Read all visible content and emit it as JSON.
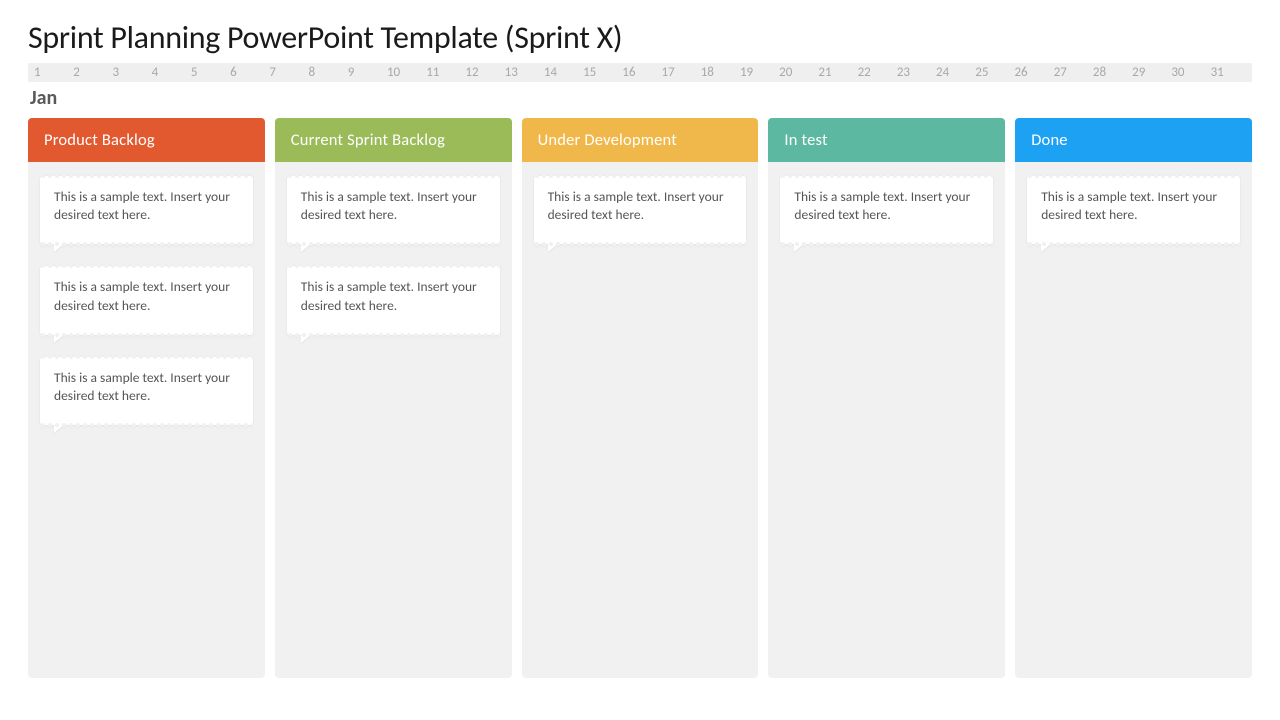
{
  "title": "Sprint Planning PowerPoint Template (Sprint X)",
  "month": "Jan",
  "days": [
    "1",
    "2",
    "3",
    "4",
    "5",
    "6",
    "7",
    "8",
    "9",
    "10",
    "11",
    "12",
    "13",
    "14",
    "15",
    "16",
    "17",
    "18",
    "19",
    "20",
    "21",
    "22",
    "23",
    "24",
    "25",
    "26",
    "27",
    "28",
    "29",
    "30",
    "31"
  ],
  "sample_text": "This is a sample text. Insert your desired text here.",
  "columns": [
    {
      "title": "Product Backlog",
      "color": "#E2592F",
      "card_count": 3
    },
    {
      "title": "Current Sprint Backlog",
      "color": "#9BBB59",
      "card_count": 2
    },
    {
      "title": "Under Development",
      "color": "#F0B84A",
      "card_count": 1
    },
    {
      "title": "In test",
      "color": "#5CB8A0",
      "card_count": 1
    },
    {
      "title": "Done",
      "color": "#1DA1F2",
      "card_count": 1
    }
  ]
}
